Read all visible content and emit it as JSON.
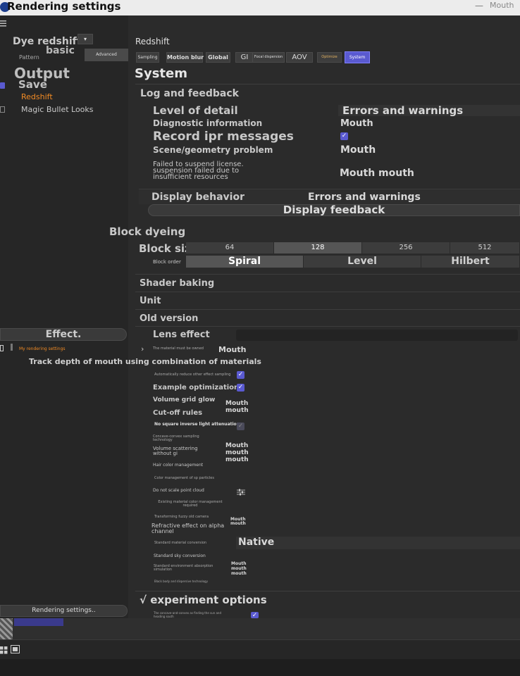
{
  "window": {
    "title": "Rendering settings",
    "dash": "—",
    "corner_label": "Mouth"
  },
  "sidebar": {
    "preset_name": "Dye redshift",
    "preset_sub": "basic",
    "pattern_label": "Pattern",
    "advanced_label": "Advanced",
    "output_heading": "Output",
    "save_label": "Save",
    "tree": [
      {
        "label": "Redshift",
        "checked": true,
        "active": true
      },
      {
        "label": "Magic Bullet Looks",
        "checked": false,
        "active": false
      }
    ],
    "effect_button": "Effect.",
    "my_settings": "My rendering settings",
    "settings_button": "Rendering settings.."
  },
  "main": {
    "renderer": "Redshift",
    "tabs": [
      "Sampling",
      "Motion blur",
      "Global",
      "GI",
      "Focal dispersion",
      "AOV",
      "Optimize",
      "System"
    ],
    "active_tab": "System",
    "section_title": "System",
    "log": {
      "heading": "Log and feedback",
      "level_label": "Level of detail",
      "level_value": "Errors and warnings",
      "diag_label": "Diagnostic information",
      "diag_value": "Mouth",
      "ipr_label": "Record ipr messages",
      "scene_label": "Scene/geometry problem",
      "scene_value": "Mouth",
      "license_label": "Failed to suspend license. suspension failed due to insufficient resources",
      "license_value": "Mouth mouth",
      "display_label": "Display behavior",
      "display_value": "Errors and warnings",
      "feedback_button": "Display feedback"
    },
    "block": {
      "heading": "Block dyeing",
      "size_label": "Block size",
      "sizes": [
        "64",
        "128",
        "256",
        "512"
      ],
      "selected_size": "128",
      "order_label": "Block order",
      "orders": [
        "Spiral",
        "Level",
        "Hilbert"
      ],
      "selected_order": "Spiral"
    },
    "collapsed": [
      "Shader baking",
      "Unit",
      "Old version"
    ],
    "lens": {
      "label": "Lens effect",
      "owned_label": "The material must be owned",
      "owned_value": "Mouth",
      "track_label": "Track depth of mouth using combination of materials"
    },
    "options": {
      "auto_reduce": "Automatically reduce other effect sampling",
      "example_opt": "Example optimization",
      "volume_glow": "Volume grid glow",
      "volume_glow_value": "Mouth mouth",
      "cutoff": "Cut-off rules",
      "no_square": "No square inverse light attenuation",
      "concave": "Concave-convex sampling technology",
      "vol_scatter": "Volume scattering without gi",
      "vol_scatter_value": "Mouth mouth mouth",
      "hair_color": "Hair color management",
      "color_sp": "Color management of sp particles",
      "no_scale": "Do not scale point cloud",
      "existing": "Existing material color management required",
      "fuzzy": "Transforming fuzzy old camera",
      "fuzzy_value": "Mouth mouth",
      "refractive": "Refractive effect on alpha channel",
      "std_material": "Standard material conversion",
      "std_material_value": "Native",
      "std_sky": "Standard sky conversion",
      "std_env": "Standard environment absorption simulation",
      "std_env_value": "Mouth mouth mouth",
      "blackbody": "Black body and dispersive technology"
    },
    "experiment": {
      "heading": "√ experiment options",
      "concave_mix": "The concave-and-convex as finding the sun and heading south"
    }
  }
}
